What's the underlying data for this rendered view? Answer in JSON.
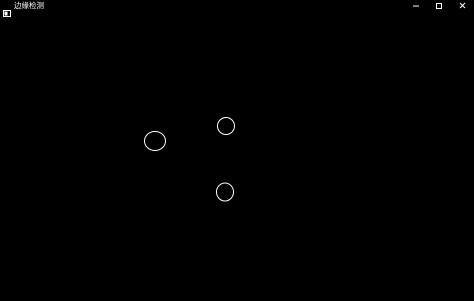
{
  "window": {
    "title": "边缘检测",
    "background_color": "#000000",
    "title_color": "#ffffff"
  },
  "titlebar": {
    "app_icon": "window-app-icon",
    "buttons": [
      {
        "name": "minimize-icon"
      },
      {
        "name": "maximize-icon"
      },
      {
        "name": "close-icon"
      }
    ]
  },
  "canvas": {
    "stroke_color": "#ffffff",
    "shapes": [
      "circle-edge",
      "circle-edge",
      "circle-edge"
    ]
  }
}
